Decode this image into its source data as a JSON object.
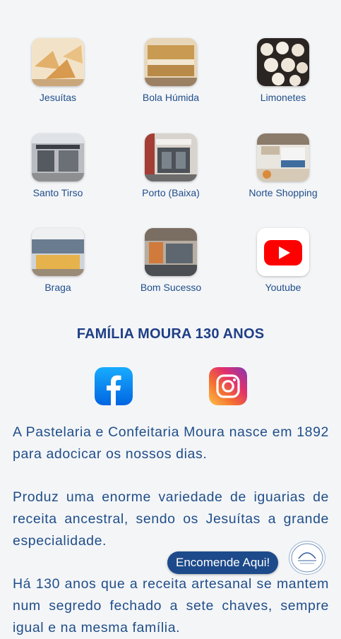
{
  "grid": [
    {
      "label": "Jesuítas",
      "icon": "jesuitas-photo"
    },
    {
      "label": "Bola Húmida",
      "icon": "bola-humida-photo"
    },
    {
      "label": "Limonetes",
      "icon": "limonetes-photo"
    },
    {
      "label": "Santo Tirso",
      "icon": "santo-tirso-store-photo"
    },
    {
      "label": "Porto (Baixa)",
      "icon": "porto-baixa-store-photo"
    },
    {
      "label": "Norte Shopping",
      "icon": "norte-shopping-store-photo"
    },
    {
      "label": "Braga",
      "icon": "braga-store-photo"
    },
    {
      "label": "Bom Sucesso",
      "icon": "bom-sucesso-store-photo"
    },
    {
      "label": "Youtube",
      "icon": "youtube-icon"
    }
  ],
  "title": "FAMÍLIA MOURA 130 ANOS",
  "social": {
    "facebook": "facebook-icon",
    "instagram": "instagram-icon"
  },
  "paragraphs": [
    "A Pastelaria e Confeitaria Moura nasce em 1892 para adocicar os nossos dias.",
    "Produz uma enorme variedade de iguarias de receita ancestral, sendo os Jesuítas a grande especialidade.",
    "Há 130 anos que a receita artesanal se mantem num segredo fechado a sete chaves, sempre igual e na mesma família."
  ],
  "order_button": "Encomende Aqui!",
  "colors": {
    "brand_blue": "#1f4e8a",
    "title_blue": "#1f3f86",
    "button_blue": "#1d4a8a"
  }
}
